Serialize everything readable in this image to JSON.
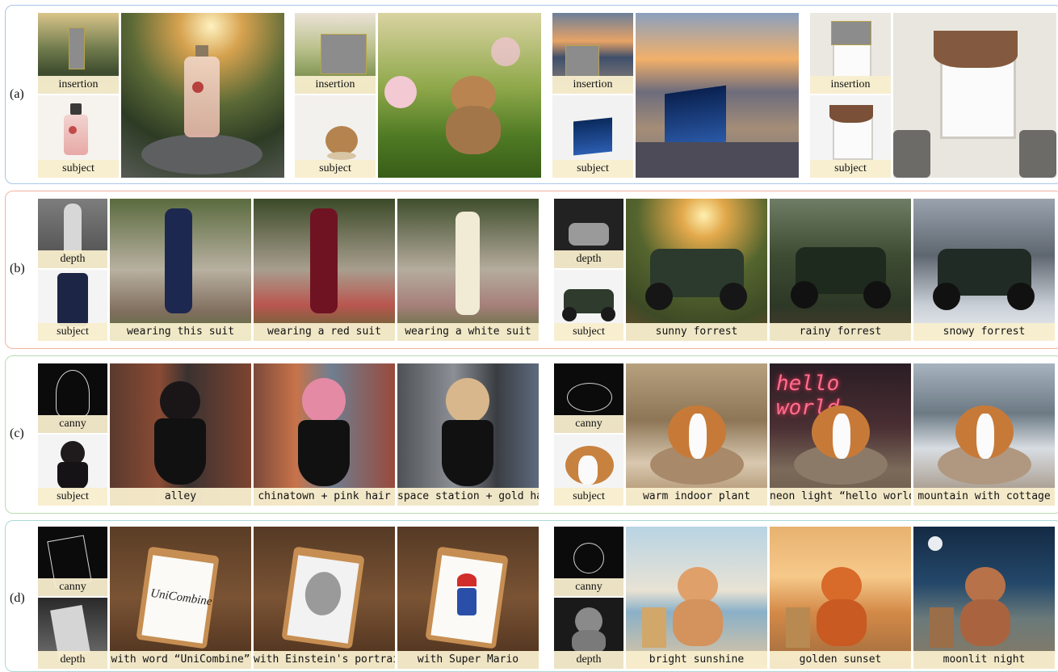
{
  "rows": [
    {
      "id": "a",
      "label": "(a)",
      "border": "#a8c7e6"
    },
    {
      "id": "b",
      "label": "(b)",
      "border": "#f2b3a3"
    },
    {
      "id": "c",
      "label": "(c)",
      "border": "#b8dcb0"
    },
    {
      "id": "d",
      "label": "(d)",
      "border": "#a8d9d6"
    }
  ],
  "captions": {
    "insertion": "insertion",
    "subject": "subject",
    "depth": "depth",
    "canny": "canny",
    "b_left": [
      "wearing this suit",
      "wearing a red suit",
      "wearing a white suit"
    ],
    "b_right": [
      "sunny forrest",
      "rainy forrest",
      "snowy forrest"
    ],
    "c_left": [
      "alley",
      "chinatown + pink hair",
      "space station + gold hair"
    ],
    "c_right": [
      "warm indoor plant",
      "neon light “hello world”",
      "mountain with cottage"
    ],
    "d_left": [
      "with word “UniCombine”",
      "with Einstein's portrait",
      "with Super Mario"
    ],
    "d_right": [
      "bright sunshine",
      "golden sunset",
      "moonlit night"
    ]
  },
  "sign_text": "UniCombine",
  "neon_text": "hello world"
}
